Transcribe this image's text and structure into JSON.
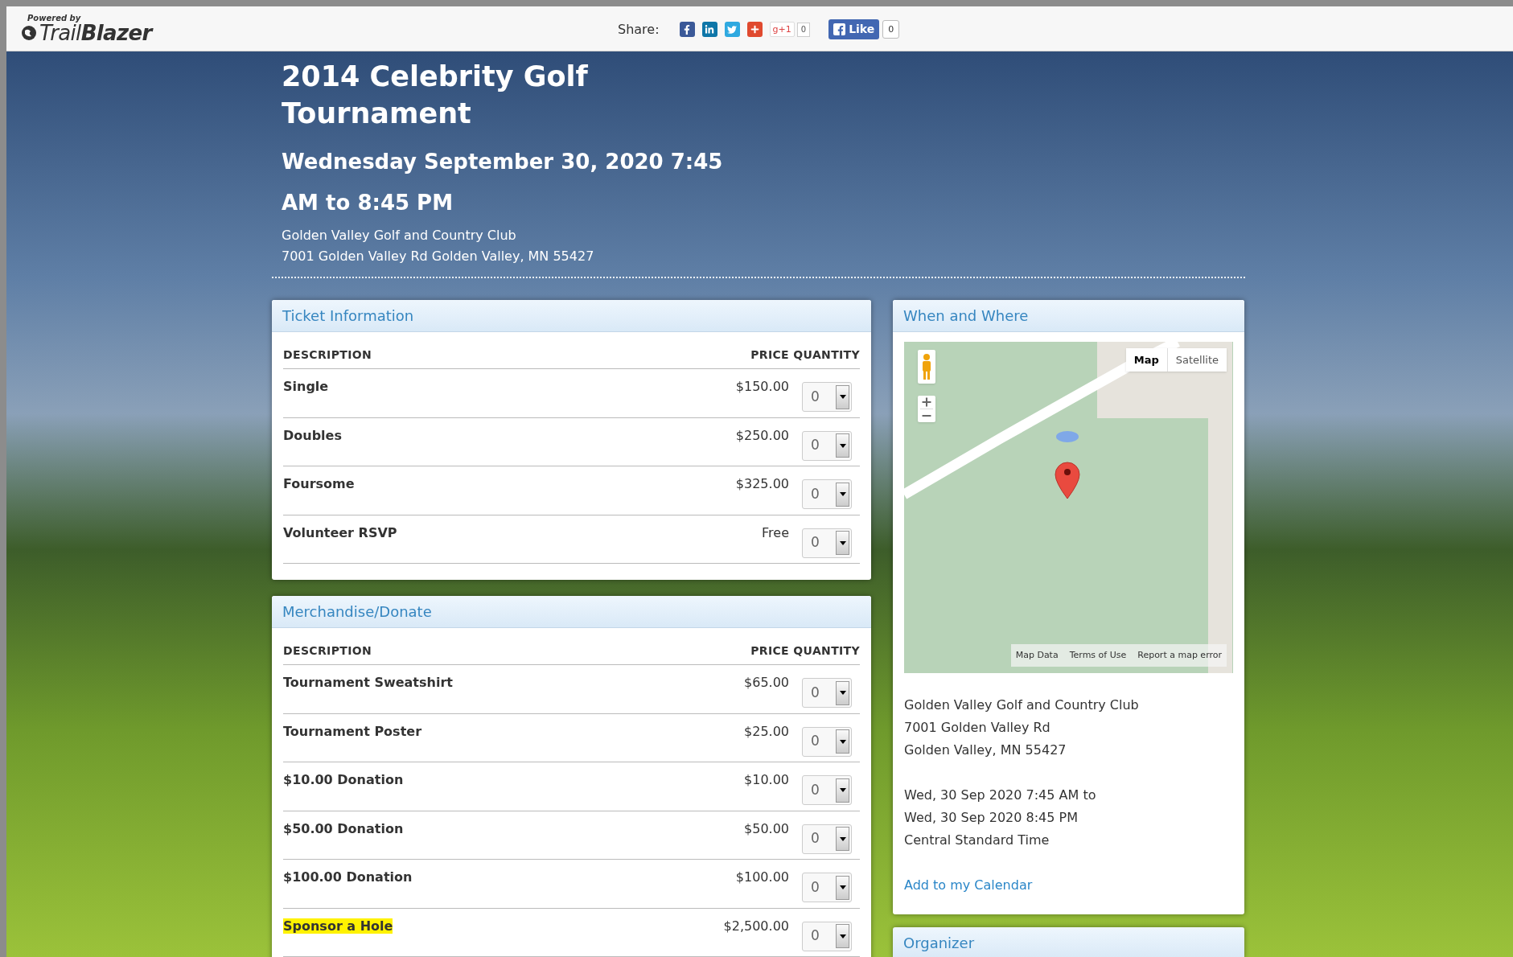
{
  "header": {
    "powered_by": "Powered by",
    "brand_light": "Trail",
    "brand_bold": "Blazer",
    "share_label": "Share:",
    "gplus": {
      "label": "g+1",
      "count": "0"
    },
    "like": {
      "label": "Like",
      "count": "0"
    }
  },
  "event": {
    "title": "2014 Celebrity Golf Tournament",
    "date": "Wednesday September 30, 2020 7:45 AM to 8:45 PM",
    "venue": "Golden Valley Golf and Country Club",
    "address": "7001 Golden Valley Rd Golden Valley, MN 55427"
  },
  "panels": [
    {
      "title": "Ticket Information",
      "columns": [
        "DESCRIPTION",
        "PRICE",
        "QUANTITY"
      ],
      "rows": [
        {
          "description": "Single",
          "price": "$150.00",
          "quantity": "0",
          "highlighted": false
        },
        {
          "description": "Doubles",
          "price": "$250.00",
          "quantity": "0",
          "highlighted": false
        },
        {
          "description": "Foursome",
          "price": "$325.00",
          "quantity": "0",
          "highlighted": false
        },
        {
          "description": "Volunteer RSVP",
          "price": "Free",
          "quantity": "0",
          "highlighted": false
        }
      ]
    },
    {
      "title": "Merchandise/Donate",
      "columns": [
        "DESCRIPTION",
        "PRICE",
        "QUANTITY"
      ],
      "rows": [
        {
          "description": "Tournament Sweatshirt",
          "price": "$65.00",
          "quantity": "0",
          "highlighted": false
        },
        {
          "description": "Tournament Poster",
          "price": "$25.00",
          "quantity": "0",
          "highlighted": false
        },
        {
          "description": "$10.00 Donation",
          "price": "$10.00",
          "quantity": "0",
          "highlighted": false
        },
        {
          "description": "$50.00 Donation",
          "price": "$50.00",
          "quantity": "0",
          "highlighted": false
        },
        {
          "description": "$100.00 Donation",
          "price": "$100.00",
          "quantity": "0",
          "highlighted": false
        },
        {
          "description": "Sponsor a Hole",
          "price": "$2,500.00",
          "quantity": "0",
          "highlighted": true
        }
      ]
    }
  ],
  "when_where": {
    "title": "When and Where",
    "map": {
      "types": [
        {
          "label": "Map",
          "selected": true
        },
        {
          "label": "Satellite",
          "selected": false
        }
      ],
      "footer_links": [
        "Map Data",
        "Terms of Use",
        "Report a map error"
      ]
    },
    "address_lines": [
      "Golden Valley Golf and Country Club",
      "7001 Golden Valley Rd",
      "Golden Valley, MN 55427"
    ],
    "time_lines": [
      "Wed, 30 Sep 2020 7:45 AM to",
      "Wed, 30 Sep 2020 8:45 PM",
      "Central Standard Time"
    ],
    "calendar_link": "Add to my Calendar"
  },
  "organizer": {
    "title": "Organizer"
  }
}
